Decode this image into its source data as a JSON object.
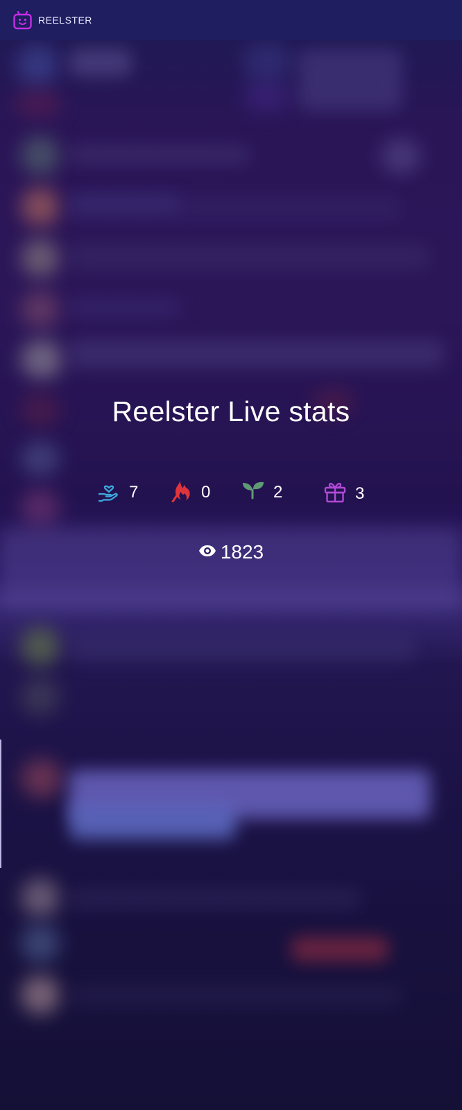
{
  "app": {
    "name": "REELSTER"
  },
  "stats_panel": {
    "title": "Reelster Live stats",
    "stats": [
      {
        "icon": "hand-heart-icon",
        "value": "7",
        "color": "#3fa9dc"
      },
      {
        "icon": "flame-icon",
        "value": "0",
        "color": "#e0343c"
      },
      {
        "icon": "sprout-icon",
        "value": "2",
        "color": "#5f9a74"
      },
      {
        "icon": "gift-icon",
        "value": "3",
        "color": "#b14ad6"
      }
    ],
    "viewers": {
      "icon": "eye-icon",
      "value": "1823"
    }
  },
  "colors": {
    "logo": "#c42ee6",
    "accent_blue": "#3fa9dc",
    "accent_red": "#e0343c",
    "accent_green": "#5f9a74",
    "accent_purple": "#b14ad6"
  }
}
